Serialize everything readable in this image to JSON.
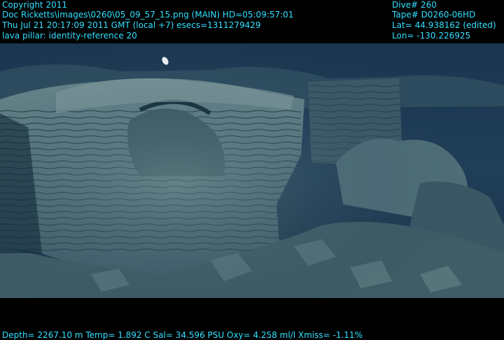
{
  "overlay": {
    "left_lines": [
      "Copyright 2011",
      "Doc Ricketts\\images\\0260\\05_09_57_15.png (MAIN)  HD=05:09:57:01",
      "Thu Jul 21 20:17:09 2011 GMT (local +7)  esecs=1311279429",
      "lava pillar: identity-reference 20"
    ],
    "right_lines": [
      "Dive# 260",
      "Tape# D0260-06HD",
      "Lat= 44.938162 (edited)",
      "Lon= -130.226925"
    ],
    "bottom_line": "Depth= 2267.10 m  Temp= 1.892 C  Sal= 34.596 PSU  Oxy= 4.258 ml/l  Xmiss= -1.11%"
  },
  "colors": {
    "overlay_text": "#33e0ff",
    "water": "#1d3a52",
    "rock": "#5f7f86",
    "shadow": "#0f2232"
  }
}
